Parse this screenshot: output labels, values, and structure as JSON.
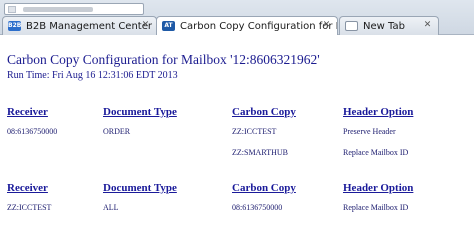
{
  "browser": {
    "tabs": [
      {
        "label": "B2B Management Center",
        "icon": "b2b-favicon-icon"
      },
      {
        "label": "Carbon Copy Configuration for Mailbox '12:...",
        "icon": "att-favicon-icon"
      },
      {
        "label": "New Tab",
        "icon": "new-tab-favicon-icon"
      }
    ]
  },
  "page": {
    "title": "Carbon Copy Configuration for Mailbox '12:8606321962'",
    "run_time": "Run Time: Fri Aug 16 12:31:06 EDT 2013"
  },
  "tables": [
    {
      "headers": {
        "receiver": "Receiver",
        "document_type": "Document Type",
        "carbon_copy": "Carbon Copy",
        "header_option": "Header Option"
      },
      "rows": [
        {
          "receiver": "08:6136750000",
          "document_type": "ORDER",
          "carbon_copy": "ZZ:ICCTEST",
          "header_option": "Preserve Header"
        },
        {
          "receiver": "",
          "document_type": "",
          "carbon_copy": "ZZ:SMARTHUB",
          "header_option": "Replace Mailbox ID"
        }
      ]
    },
    {
      "headers": {
        "receiver": "Receiver",
        "document_type": "Document Type",
        "carbon_copy": "Carbon Copy",
        "header_option": "Header Option"
      },
      "rows": [
        {
          "receiver": "ZZ:ICCTEST",
          "document_type": "ALL",
          "carbon_copy": "08:6136750000",
          "header_option": "Replace Mailbox ID"
        }
      ]
    }
  ]
}
